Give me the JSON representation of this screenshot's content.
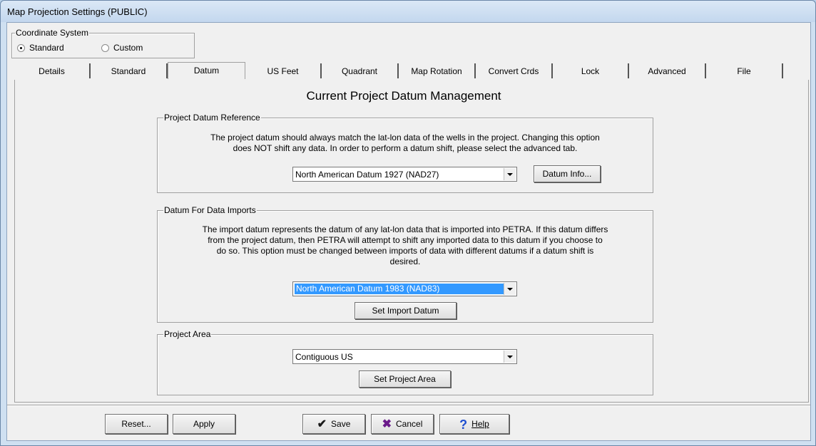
{
  "window": {
    "title": "Map Projection Settings (PUBLIC)"
  },
  "coordinate_system": {
    "legend": "Coordinate System",
    "options": [
      {
        "label": "Standard",
        "selected": true
      },
      {
        "label": "Custom",
        "selected": false
      }
    ]
  },
  "tabs": [
    {
      "label": "Details"
    },
    {
      "label": "Standard"
    },
    {
      "label": "Datum",
      "active": true
    },
    {
      "label": "US Feet"
    },
    {
      "label": "Quadrant"
    },
    {
      "label": "Map Rotation"
    },
    {
      "label": "Convert Crds"
    },
    {
      "label": "Lock"
    },
    {
      "label": "Advanced"
    },
    {
      "label": "File"
    }
  ],
  "datum_tab": {
    "heading": "Current Project Datum Management",
    "project_datum": {
      "legend": "Project Datum Reference",
      "desc_line1": "The project datum should always match the lat-lon data of the wells in the project. Changing this option",
      "desc_line2": "does NOT shift any data. In order to perform a datum shift, please select the advanced tab.",
      "selected": "North American Datum 1927 (NAD27)",
      "info_button": "Datum Info..."
    },
    "import_datum": {
      "legend": "Datum For Data Imports",
      "desc_line1": "The import datum represents the datum of any lat-lon data that is imported into PETRA. If this datum differs",
      "desc_line2": "from the project datum, then PETRA will attempt to shift any imported data to this datum if you choose to",
      "desc_line3": "do so. This option must be changed between imports of data with different datums if a datum shift is",
      "desc_line4": "desired.",
      "selected": "North American Datum 1983 (NAD83)",
      "set_button": "Set Import Datum"
    },
    "project_area": {
      "legend": "Project Area",
      "selected": "Contiguous US",
      "set_button": "Set Project Area"
    }
  },
  "footer": {
    "reset": "Reset...",
    "apply": "Apply",
    "save": "Save",
    "cancel": "Cancel",
    "help": "Help"
  },
  "colors": {
    "save_icon": "#1a1a1a",
    "cancel_icon": "#6a1a8a",
    "help_icon": "#1f4fd0",
    "selection": "#3399ff"
  }
}
